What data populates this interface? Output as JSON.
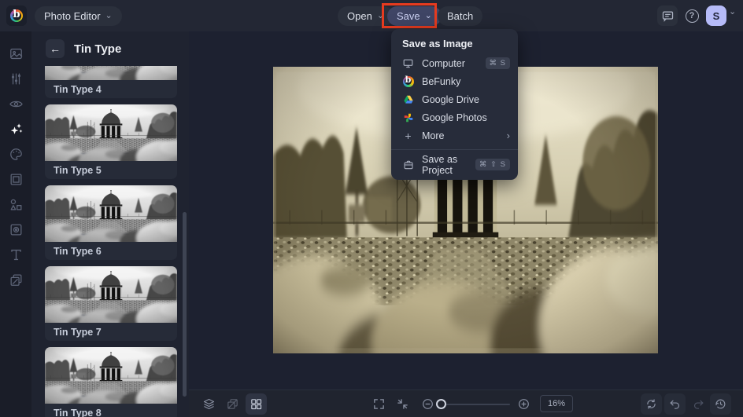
{
  "topbar": {
    "app_menu_label": "Photo Editor",
    "open_label": "Open",
    "save_label": "Save",
    "batch_label": "Batch",
    "avatar_initial": "S",
    "logo_letter": "b"
  },
  "icons": {
    "chevron_down": "⌄",
    "chevron_right": "›",
    "back_arrow": "←",
    "plus": "+",
    "question": "?"
  },
  "panel": {
    "title": "Tin Type",
    "items": [
      {
        "label": "Tin Type 4"
      },
      {
        "label": "Tin Type 5"
      },
      {
        "label": "Tin Type 6"
      },
      {
        "label": "Tin Type 7"
      },
      {
        "label": "Tin Type 8"
      }
    ]
  },
  "save_menu": {
    "title": "Save as Image",
    "items": [
      {
        "label": "Computer",
        "shortcut": "⌘ S"
      },
      {
        "label": "BeFunky"
      },
      {
        "label": "Google Drive"
      },
      {
        "label": "Google Photos"
      },
      {
        "label": "More"
      }
    ],
    "project_item": {
      "label": "Save as Project",
      "shortcut": "⌘ ⇧ S"
    }
  },
  "bottombar": {
    "zoom_value": "16%"
  },
  "colors": {
    "annotation_red": "#e63b1f",
    "avatar_bg": "#b6bbf8",
    "topbar_bg": "#232734",
    "canvas_bg": "#1d2130",
    "save_button_bg": "#3f4565"
  }
}
